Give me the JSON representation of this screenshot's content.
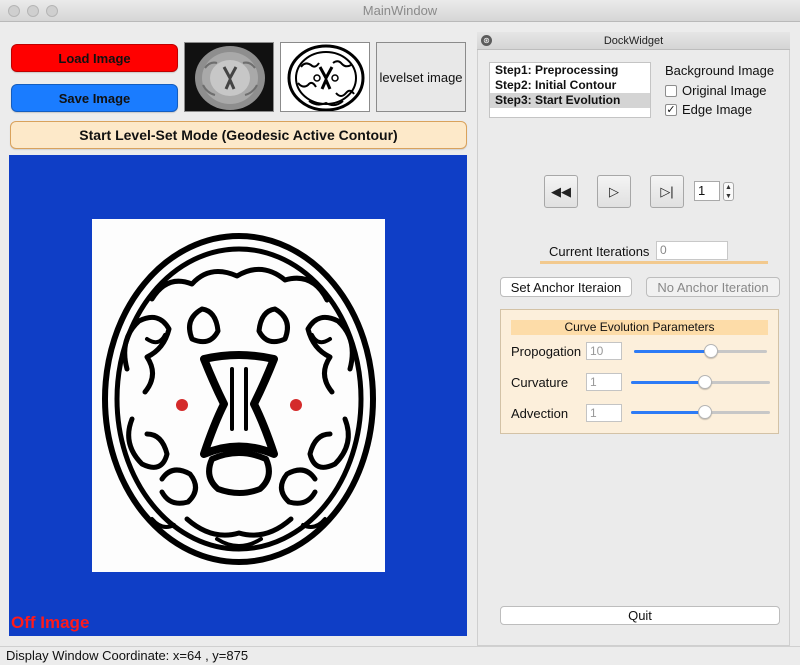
{
  "window": {
    "title": "MainWindow"
  },
  "left": {
    "load_label": "Load Image",
    "save_label": "Save Image",
    "levelset_label": "levelset image",
    "start_label": "Start Level-Set Mode (Geodesic Active Contour)",
    "canvas_overlay": "Off Image"
  },
  "dock": {
    "title": "DockWidget",
    "steps": [
      "Step1: Preprocessing",
      "Step2: Initial Contour",
      "Step3: Start Evolution"
    ],
    "selected_step": "Step3: Start Evolution",
    "background_label": "Background Image",
    "original_label": "Original Image",
    "original_checked": false,
    "edge_label": "Edge Image",
    "edge_checked": true,
    "spin_value": "1",
    "iter_label": "Current Iterations",
    "iter_value": "0",
    "anchor_label": "Set Anchor Iteraion",
    "noanchor_label": "No Anchor Iteration",
    "params": {
      "title": "Curve Evolution Parameters",
      "rows": [
        {
          "label": "Propogation",
          "value": "10",
          "level": 0.58
        },
        {
          "label": "Curvature",
          "value": "1",
          "level": 0.53
        },
        {
          "label": "Advection",
          "value": "1",
          "level": 0.53
        }
      ]
    },
    "quit_label": "Quit"
  },
  "status": {
    "text": "Display Window Coordinate: x=64 , y=875"
  },
  "colors": {
    "load_button": "#ff0000",
    "save_button": "#1a7cff",
    "canvas_background": "#0f3ec6",
    "slider_accent": "#2d7bf6",
    "seed_points": "#d42b2b"
  }
}
